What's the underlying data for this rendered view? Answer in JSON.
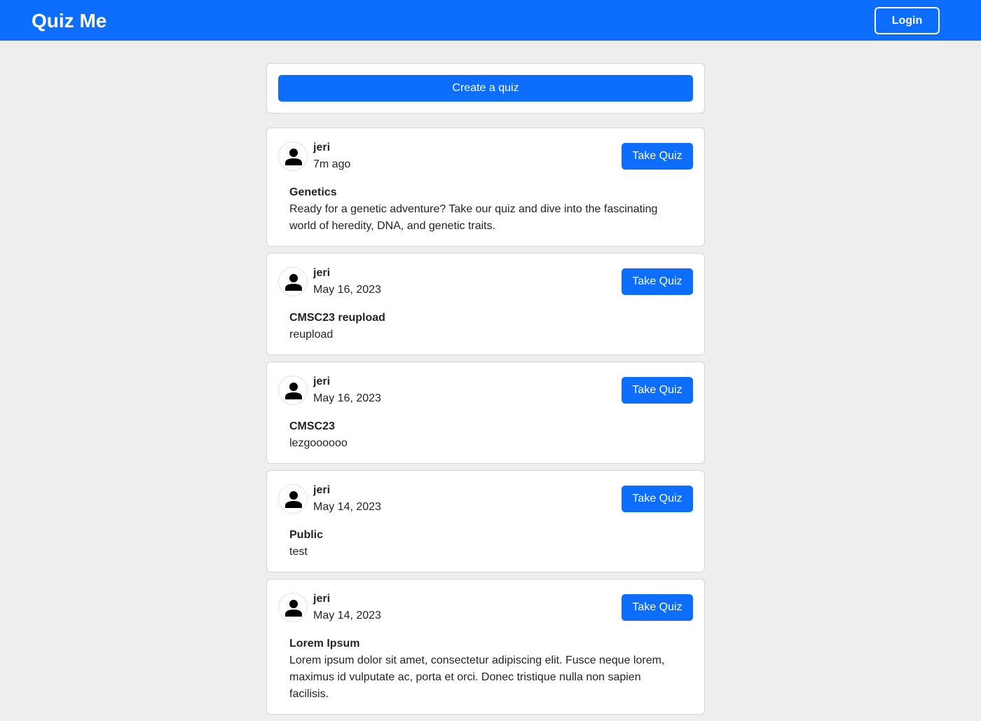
{
  "navbar": {
    "brand": "Quiz Me",
    "login_label": "Login"
  },
  "create": {
    "label": "Create a quiz"
  },
  "take_label": "Take Quiz",
  "quizzes": [
    {
      "author": "jeri",
      "time": "7m ago",
      "title": "Genetics",
      "description": "Ready for a genetic adventure? Take our quiz and dive into the fascinating world of heredity, DNA, and genetic traits."
    },
    {
      "author": "jeri",
      "time": "May 16, 2023",
      "title": "CMSC23 reupload",
      "description": "reupload"
    },
    {
      "author": "jeri",
      "time": "May 16, 2023",
      "title": "CMSC23",
      "description": "lezgoooooo"
    },
    {
      "author": "jeri",
      "time": "May 14, 2023",
      "title": "Public",
      "description": "test"
    },
    {
      "author": "jeri",
      "time": "May 14, 2023",
      "title": "Lorem Ipsum",
      "description": "Lorem ipsum dolor sit amet, consectetur adipiscing elit. Fusce neque lorem, maximus id vulputate ac, porta et orci. Donec tristique nulla non sapien facilisis."
    }
  ],
  "icons": {
    "avatar": "person-icon"
  },
  "colors": {
    "primary": "#0d6efd",
    "background": "#eeeeee"
  }
}
